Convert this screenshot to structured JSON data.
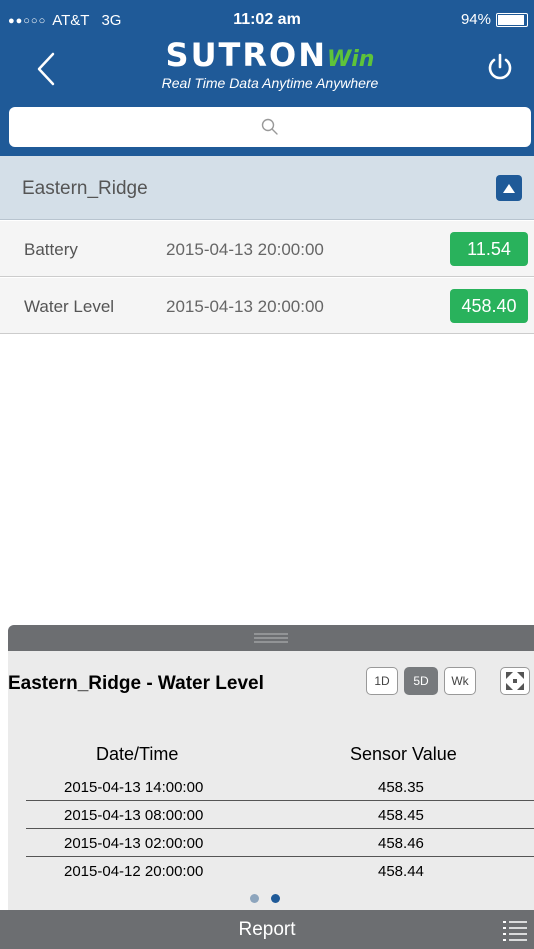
{
  "status_bar": {
    "signal": "●●○○○",
    "carrier": "AT&T",
    "network": "3G",
    "time": "11:02 am",
    "battery": "94%",
    "battery_level": 0.94
  },
  "header": {
    "logo_main": "SUTRON",
    "logo_win": "Win",
    "tagline": "Real Time Data Anytime Anywhere"
  },
  "search": {
    "placeholder": ""
  },
  "group": {
    "title": "Eastern_Ridge",
    "rows": [
      {
        "name": "Battery",
        "time": "2015-04-13 20:00:00",
        "value": "11.54"
      },
      {
        "name": "Water Level",
        "time": "2015-04-13 20:00:00",
        "value": "458.40"
      }
    ]
  },
  "panel": {
    "title": "Eastern_Ridge - Water Level",
    "ranges": [
      "1D",
      "5D",
      "Wk"
    ],
    "active_range": "5D",
    "col_time": "Date/Time",
    "col_value": "Sensor Value",
    "rows": [
      {
        "time": "2015-04-13 14:00:00",
        "value": "458.35"
      },
      {
        "time": "2015-04-13 08:00:00",
        "value": "458.45"
      },
      {
        "time": "2015-04-13 02:00:00",
        "value": "458.46"
      },
      {
        "time": "2015-04-12 20:00:00",
        "value": "458.44"
      }
    ],
    "page_count": 2,
    "active_page": 2
  },
  "footer": {
    "report_label": "Report"
  },
  "colors": {
    "brand": "#1f5a98",
    "value_green": "#29b25c",
    "panel_gray": "#6c6e71"
  }
}
